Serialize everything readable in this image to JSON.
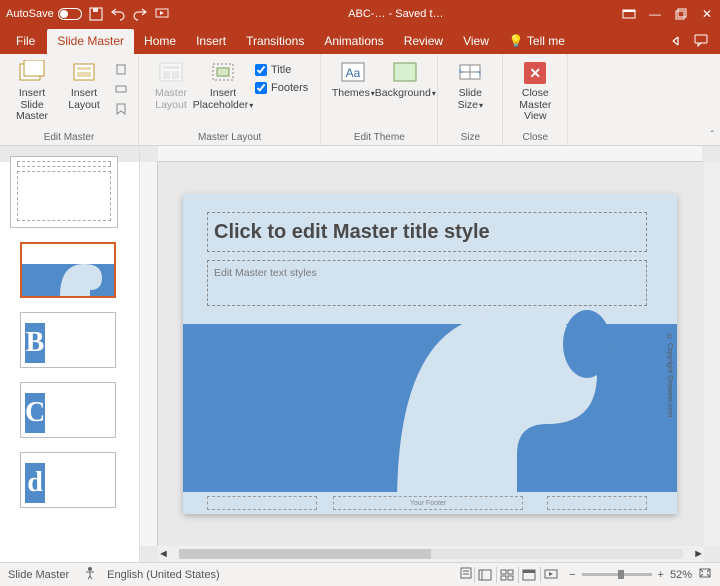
{
  "titlebar": {
    "autosave": "AutoSave",
    "doc": "ABC-… - Saved t…"
  },
  "tabs": {
    "file": "File",
    "slidemaster": "Slide Master",
    "home": "Home",
    "insert": "Insert",
    "transitions": "Transitions",
    "animations": "Animations",
    "review": "Review",
    "view": "View",
    "tellme": "Tell me"
  },
  "ribbon": {
    "insertSlideMaster": "Insert Slide Master",
    "insertLayout": "Insert Layout",
    "editMasterGroup": "Edit Master",
    "masterLayout": "Master Layout",
    "insertPlaceholder": "Insert Placeholder",
    "chkTitle": "Title",
    "chkFooters": "Footers",
    "masterLayoutGroup": "Master Layout",
    "themes": "Themes",
    "background": "Background",
    "editThemeGroup": "Edit Theme",
    "slideSize": "Slide Size",
    "sizeGroup": "Size",
    "closeMaster": "Close Master View",
    "closeGroup": "Close"
  },
  "slide": {
    "title": "Click to edit Master title style",
    "body": "Edit Master text styles",
    "footerCenter": "Your Footer",
    "copyright": "© Copyright Showeet.com"
  },
  "status": {
    "mode": "Slide Master",
    "lang": "English (United States)",
    "zoom": "52%"
  }
}
